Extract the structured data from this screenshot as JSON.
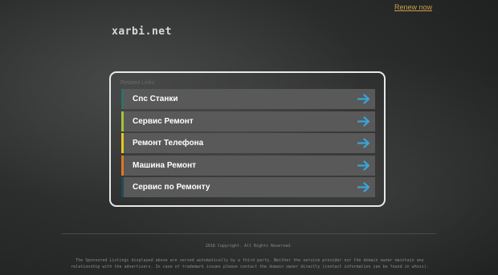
{
  "header": {
    "renew_label": "Renew now",
    "domain": "xarbi.net"
  },
  "related": {
    "heading": "Related Links",
    "items": [
      {
        "label": "Cnc Станки",
        "color": "#2f6f6a"
      },
      {
        "label": "Сервис Ремонт",
        "color": "#a4c33a"
      },
      {
        "label": "Ремонт Телефона",
        "color": "#e4c820"
      },
      {
        "label": "Машина Ремонт",
        "color": "#e0771f"
      },
      {
        "label": "Сервис по Ремонту",
        "color": "#1e4a5a"
      }
    ],
    "arrow_icon": "arrow-right-icon",
    "arrow_color": "#3aa3d6"
  },
  "footer": {
    "copyright": "2018 Copyright. All Rights Reserved.",
    "disclaimer": "The Sponsored Listings displayed above are served automatically by a third party. Neither the service provider nor the domain owner maintain any relationship with the advertisers. In case of trademark issues please contact the domain owner directly (contact information can be found in whois)."
  }
}
